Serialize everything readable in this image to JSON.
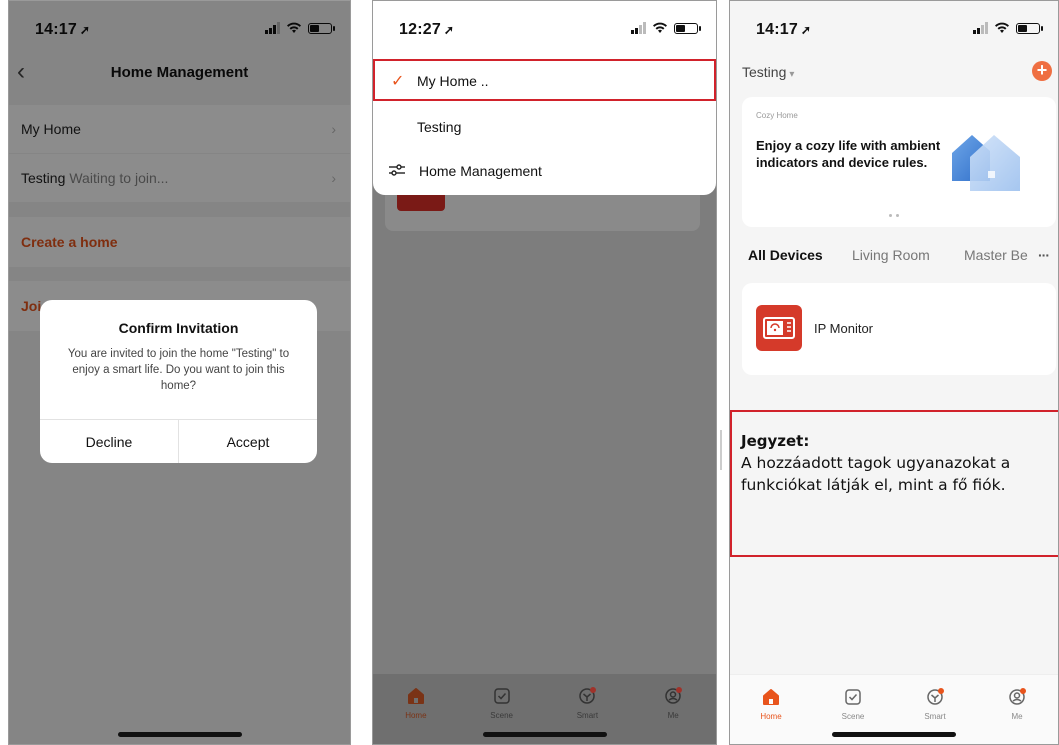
{
  "phone1": {
    "time": "14:17",
    "nav_title": "Home Management",
    "rows": [
      {
        "label": "My Home",
        "sub": ""
      },
      {
        "label": "Testing",
        "sub": "Waiting to join..."
      }
    ],
    "create_home": "Create a home",
    "join_partial": "Joi",
    "dialog": {
      "title": "Confirm Invitation",
      "message": "You are invited to join the home \"Testing\" to enjoy a smart life. Do you want to join this home?",
      "decline": "Decline",
      "accept": "Accept"
    }
  },
  "phone2": {
    "time": "12:27",
    "menu": {
      "selected": "My Home ..",
      "other": "Testing",
      "manage": "Home Management"
    },
    "tabs": [
      "Home",
      "Scene",
      "Smart",
      "Me"
    ]
  },
  "phone3": {
    "time": "14:17",
    "home_name": "Testing",
    "banner": {
      "subtitle": "Cozy Home",
      "title": "Enjoy a cozy life with ambient indicators and device rules."
    },
    "room_tabs": [
      "All Devices",
      "Living Room",
      "Master Be"
    ],
    "more": "···",
    "device": "IP Monitor",
    "note": {
      "title": "Jegyzet:",
      "body": "A hozzáadott tagok ugyanazokat a funkciókat látják el, mint a fő fiók."
    },
    "tabs": [
      "Home",
      "Scene",
      "Smart",
      "Me"
    ]
  },
  "colors": {
    "accent": "#e8541c",
    "highlight_border": "#d1222b",
    "device_red": "#d53a2a"
  }
}
